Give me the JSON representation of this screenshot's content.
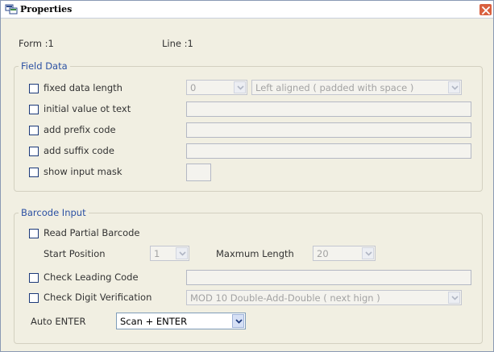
{
  "window": {
    "title": "Properties"
  },
  "header": {
    "form_label": "Form :1",
    "line_label": "Line :1"
  },
  "field_data": {
    "legend": "Field Data",
    "fixed_length": {
      "label": "fixed data length",
      "checked": false,
      "length_value": "0",
      "alignment_value": "Left aligned ( padded with space )"
    },
    "initial_value": {
      "label": "initial value ot text",
      "checked": false,
      "value": ""
    },
    "prefix": {
      "label": "add prefix code",
      "checked": false,
      "value": ""
    },
    "suffix": {
      "label": "add suffix code",
      "checked": false,
      "value": ""
    },
    "input_mask": {
      "label": "show input mask",
      "checked": false,
      "value": ""
    }
  },
  "barcode_input": {
    "legend": "Barcode Input",
    "partial": {
      "label": "Read Partial Barcode",
      "checked": false
    },
    "start_position": {
      "label": "Start Position",
      "value": "1"
    },
    "max_length": {
      "label": "Maxmum Length",
      "value": "20"
    },
    "leading_code": {
      "label": "Check Leading Code",
      "checked": false,
      "value": ""
    },
    "digit_verification": {
      "label": "Check Digit Verification",
      "checked": false,
      "value": "MOD 10 Double-Add-Double ( next hign )"
    },
    "auto_enter": {
      "label": "Auto ENTER",
      "value": "Scan + ENTER"
    }
  },
  "colors": {
    "legend_text": "#2c51a3",
    "background": "#f1efe2",
    "close_button": "#d9603f"
  },
  "icons": {
    "app": "properties-app-icon",
    "close": "close-icon",
    "dropdown": "chevron-down-icon"
  }
}
